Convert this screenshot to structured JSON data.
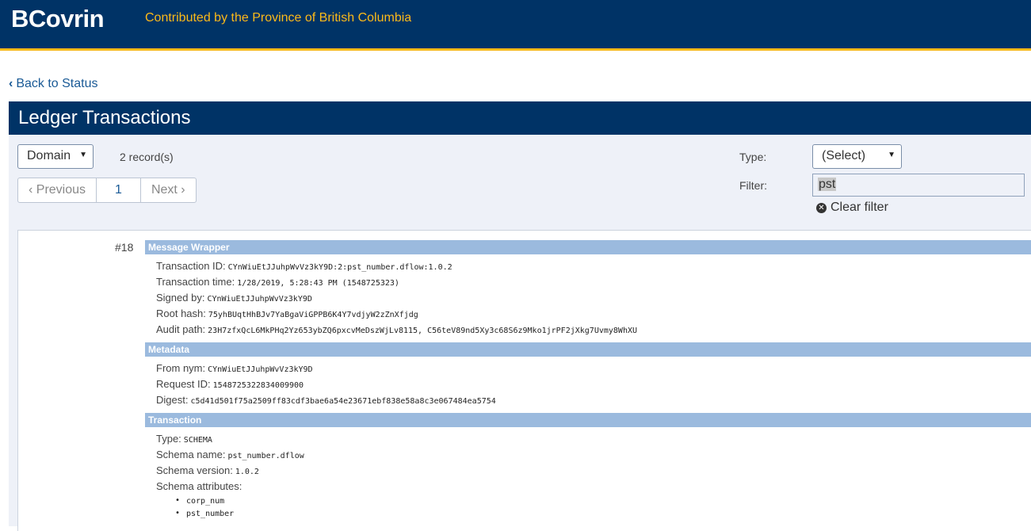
{
  "header": {
    "brand": "BCovrin",
    "tagline": "Contributed by the Province of British Columbia"
  },
  "back_link": "Back to Status",
  "panel": {
    "title": "Ledger Transactions",
    "ledger_select": "Domain",
    "record_count": "2 record(s)",
    "pager": {
      "prev": "Previous",
      "current": "1",
      "next": "Next"
    },
    "type_label": "Type:",
    "type_select": "(Select)",
    "filter_label": "Filter:",
    "filter_value": "pst",
    "clear_filter": "Clear filter"
  },
  "record": {
    "number": "#18",
    "message_wrapper": {
      "heading": "Message Wrapper",
      "rows": [
        {
          "label": "Transaction ID:",
          "value": "CYnWiuEtJJuhpWvVz3kY9D:2:pst_number.dflow:1.0.2"
        },
        {
          "label": "Transaction time:",
          "value": "1/28/2019, 5:28:43 PM (1548725323)"
        },
        {
          "label": "Signed by:",
          "value": "CYnWiuEtJJuhpWvVz3kY9D"
        },
        {
          "label": "Root hash:",
          "value": "75yhBUqtHhBJv7YaBgaViGPPB6K4Y7vdjyW2zZnXfjdg"
        },
        {
          "label": "Audit path:",
          "value": "23H7zfxQcL6MkPHq2Yz653ybZQ6pxcvMeDszWjLv8115, C56teV89nd5Xy3c68S6z9Mko1jrPF2jXkg7Uvmy8WhXU"
        }
      ]
    },
    "metadata": {
      "heading": "Metadata",
      "rows": [
        {
          "label": "From nym:",
          "value": "CYnWiuEtJJuhpWvVz3kY9D"
        },
        {
          "label": "Request ID:",
          "value": "1548725322834009900"
        },
        {
          "label": "Digest:",
          "value": "c5d41d501f75a2509ff83cdf3bae6a54e23671ebf838e58a8c3e067484ea5754"
        }
      ]
    },
    "transaction": {
      "heading": "Transaction",
      "rows": [
        {
          "label": "Type:",
          "value": "SCHEMA"
        },
        {
          "label": "Schema name:",
          "value": "pst_number.dflow"
        },
        {
          "label": "Schema version:",
          "value": "1.0.2"
        },
        {
          "label": "Schema attributes:",
          "value": ""
        }
      ],
      "attributes": [
        "corp_num",
        "pst_number"
      ]
    }
  }
}
